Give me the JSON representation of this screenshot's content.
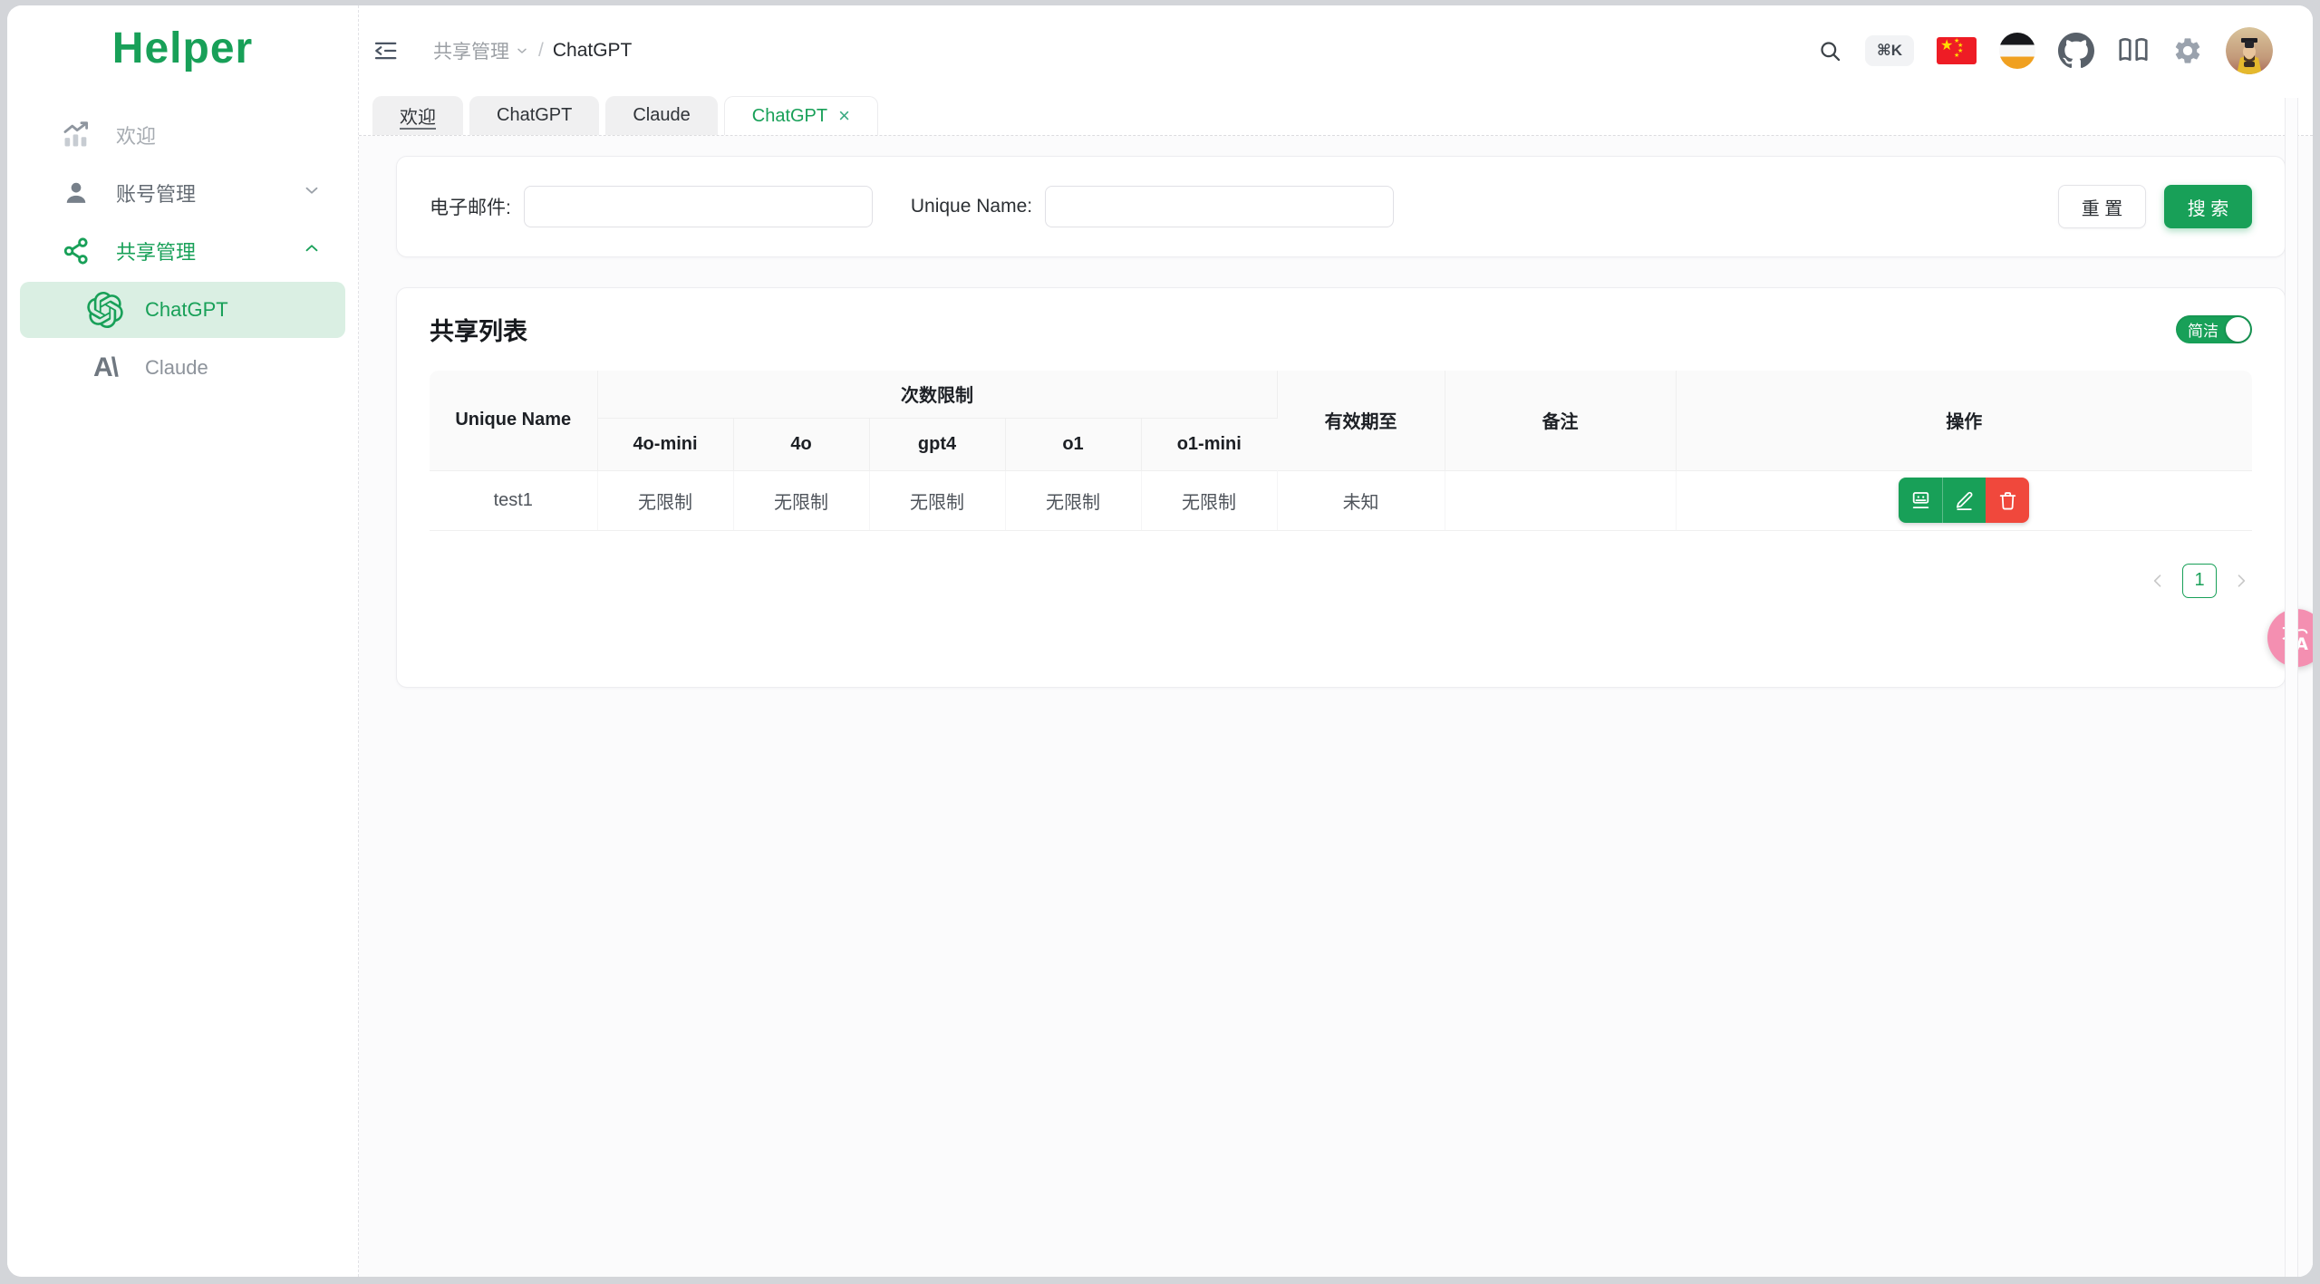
{
  "sidebar": {
    "logo": "Helper",
    "items": [
      {
        "label": "欢迎",
        "icon": "trend-chart"
      },
      {
        "label": "账号管理",
        "icon": "user",
        "chevron": "down"
      },
      {
        "label": "共享管理",
        "icon": "share",
        "chevron": "up",
        "active": true
      }
    ],
    "subitems": [
      {
        "label": "ChatGPT",
        "icon": "openai-logo",
        "selected": true
      },
      {
        "label": "Claude",
        "icon": "anthropic-logo"
      }
    ]
  },
  "header": {
    "breadcrumb": {
      "parent": "共享管理",
      "current": "ChatGPT",
      "separator": "/"
    },
    "shortcut_badge": "⌘K"
  },
  "tabs": [
    {
      "label": "欢迎"
    },
    {
      "label": "ChatGPT"
    },
    {
      "label": "Claude"
    },
    {
      "label": "ChatGPT",
      "active": true,
      "close": "×"
    }
  ],
  "search_form": {
    "email_label": "电子邮件:",
    "email_value": "",
    "unique_name_label": "Unique Name:",
    "unique_name_value": "",
    "reset_label": "重 置",
    "search_label": "搜 索"
  },
  "share_list": {
    "title": "共享列表",
    "toggle_label": "简洁",
    "toggle_state": "on",
    "table": {
      "col_unique_name": "Unique Name",
      "col_limit_group": "次数限制",
      "limit_columns": [
        "4o-mini",
        "4o",
        "gpt4",
        "o1",
        "o1-mini"
      ],
      "col_expire": "有效期至",
      "col_remark": "备注",
      "col_actions": "操作",
      "rows": [
        {
          "unique_name": "test1",
          "limits": [
            "无限制",
            "无限制",
            "无限制",
            "无限制",
            "无限制"
          ],
          "expire": "未知",
          "remark": ""
        }
      ]
    },
    "pagination": {
      "current": "1"
    }
  },
  "colors": {
    "primary_green": "#18a058",
    "selected_item_bg": "#daefe3",
    "danger_red": "#f0483c",
    "translate_pink": "#f48fb1"
  }
}
